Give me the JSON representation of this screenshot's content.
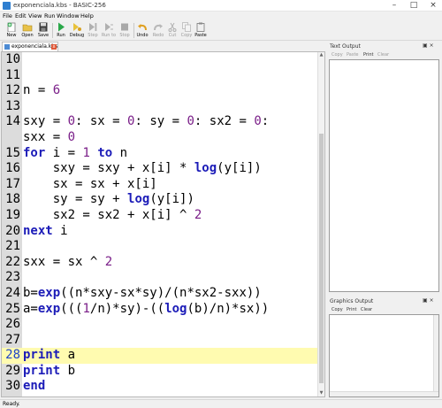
{
  "window": {
    "title": "exponenciala.kbs - BASIC-256",
    "minimize": "–",
    "maximize": "□",
    "close": "×"
  },
  "menu": [
    "File",
    "Edit",
    "View",
    "Run",
    "Window",
    "Help"
  ],
  "toolbar": {
    "new": "New",
    "open": "Open",
    "save": "Save",
    "run": "Run",
    "debug": "Debug",
    "step": "Step",
    "run_to": "Run to",
    "stop": "Stop",
    "undo": "Undo",
    "redo": "Redo",
    "cut": "Cut",
    "copy": "Copy",
    "paste": "Paste"
  },
  "tab": {
    "label": "exponenciala.kbs",
    "close": "x"
  },
  "editor": {
    "lines": [
      {
        "n": "10",
        "code": []
      },
      {
        "n": "11",
        "code": []
      },
      {
        "n": "12",
        "code": [
          [
            "t",
            "n = "
          ],
          [
            "num",
            "6"
          ]
        ]
      },
      {
        "n": "13",
        "code": []
      },
      {
        "n": "14",
        "code": [
          [
            "t",
            "sxy = "
          ],
          [
            "num",
            "0"
          ],
          [
            "t",
            ": sx = "
          ],
          [
            "num",
            "0"
          ],
          [
            "t",
            ": sy = "
          ],
          [
            "num",
            "0"
          ],
          [
            "t",
            ": sx2 = "
          ],
          [
            "num",
            "0"
          ],
          [
            "t",
            ":"
          ]
        ]
      },
      {
        "n": "",
        "code": [
          [
            "t",
            "sxx = "
          ],
          [
            "num",
            "0"
          ]
        ]
      },
      {
        "n": "15",
        "code": [
          [
            "kw",
            "for"
          ],
          [
            "t",
            " i = "
          ],
          [
            "num",
            "1"
          ],
          [
            "t",
            " "
          ],
          [
            "kw",
            "to"
          ],
          [
            "t",
            " n"
          ]
        ]
      },
      {
        "n": "16",
        "code": [
          [
            "t",
            "    sxy = sxy + x[i] * "
          ],
          [
            "fn",
            "log"
          ],
          [
            "t",
            "(y[i])"
          ]
        ]
      },
      {
        "n": "17",
        "code": [
          [
            "t",
            "    sx = sx + x[i]"
          ]
        ]
      },
      {
        "n": "18",
        "code": [
          [
            "t",
            "    sy = sy + "
          ],
          [
            "fn",
            "log"
          ],
          [
            "t",
            "(y[i])"
          ]
        ]
      },
      {
        "n": "19",
        "code": [
          [
            "t",
            "    sx2 = sx2 + x[i] ^ "
          ],
          [
            "num",
            "2"
          ]
        ]
      },
      {
        "n": "20",
        "code": [
          [
            "kw",
            "next"
          ],
          [
            "t",
            " i"
          ]
        ]
      },
      {
        "n": "21",
        "code": []
      },
      {
        "n": "22",
        "code": [
          [
            "t",
            "sxx = sx ^ "
          ],
          [
            "num",
            "2"
          ]
        ]
      },
      {
        "n": "23",
        "code": []
      },
      {
        "n": "24",
        "code": [
          [
            "t",
            "b="
          ],
          [
            "fn",
            "exp"
          ],
          [
            "t",
            "((n*sxy-sx*sy)/(n*sx2-sxx))"
          ]
        ]
      },
      {
        "n": "25",
        "code": [
          [
            "t",
            "a="
          ],
          [
            "fn",
            "exp"
          ],
          [
            "t",
            "((("
          ],
          [
            "num",
            "1"
          ],
          [
            "t",
            "/n)*sy)-(("
          ],
          [
            "fn",
            "log"
          ],
          [
            "t",
            "(b)/n)*sx))"
          ]
        ]
      },
      {
        "n": "26",
        "code": []
      },
      {
        "n": "27",
        "code": []
      },
      {
        "n": "28",
        "code": [
          [
            "kw",
            "print"
          ],
          [
            "t",
            " a"
          ]
        ],
        "highlight": true
      },
      {
        "n": "29",
        "code": [
          [
            "kw",
            "print"
          ],
          [
            "t",
            " b"
          ]
        ]
      },
      {
        "n": "30",
        "code": [
          [
            "kw",
            "end"
          ]
        ]
      }
    ]
  },
  "text_output": {
    "title": "Text Output",
    "buttons": [
      "Copy",
      "Paste",
      "Print",
      "Clear"
    ],
    "controls": "▣ ×"
  },
  "graphics_output": {
    "title": "Graphics Output",
    "buttons": [
      "Copy",
      "Print",
      "Clear"
    ],
    "controls": "▣ ×"
  },
  "status": "Ready.",
  "colors": {
    "keyword": "#1c1cb8",
    "number": "#7a1e88",
    "highlight": "#fffbb0",
    "gutter": "#dcdcdc"
  }
}
